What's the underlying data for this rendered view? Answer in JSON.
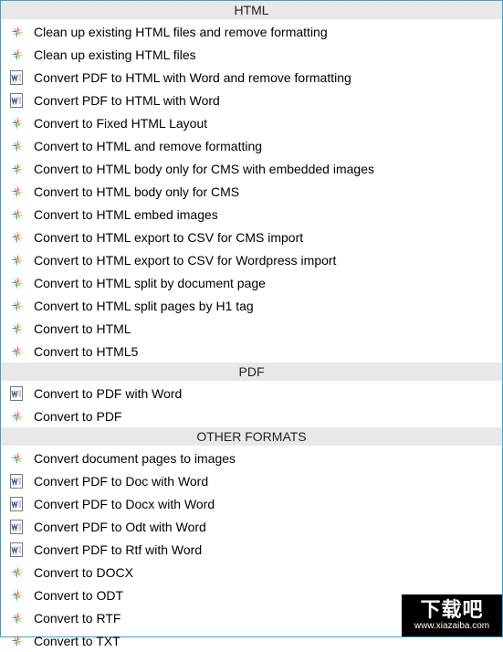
{
  "sections": [
    {
      "title": "HTML",
      "items": [
        {
          "icon": "star",
          "label": "Clean up existing HTML files and remove formatting"
        },
        {
          "icon": "star",
          "label": "Clean up existing HTML files"
        },
        {
          "icon": "word",
          "label": "Convert PDF to HTML with Word and remove formatting"
        },
        {
          "icon": "word",
          "label": "Convert PDF to HTML with Word"
        },
        {
          "icon": "star",
          "label": "Convert to Fixed HTML Layout"
        },
        {
          "icon": "star",
          "label": "Convert to HTML and remove formatting"
        },
        {
          "icon": "star",
          "label": "Convert to HTML body only for CMS with embedded images"
        },
        {
          "icon": "star",
          "label": "Convert to HTML body only for CMS"
        },
        {
          "icon": "star",
          "label": "Convert to HTML embed images"
        },
        {
          "icon": "star",
          "label": "Convert to HTML export to CSV for CMS import"
        },
        {
          "icon": "star",
          "label": "Convert to HTML export to CSV for Wordpress import"
        },
        {
          "icon": "star",
          "label": "Convert to HTML split by document page"
        },
        {
          "icon": "star",
          "label": "Convert to HTML split pages by H1 tag"
        },
        {
          "icon": "star",
          "label": "Convert to HTML"
        },
        {
          "icon": "star",
          "label": "Convert to HTML5"
        }
      ]
    },
    {
      "title": "PDF",
      "items": [
        {
          "icon": "word",
          "label": "Convert to PDF with Word"
        },
        {
          "icon": "star",
          "label": "Convert to PDF"
        }
      ]
    },
    {
      "title": "OTHER FORMATS",
      "items": [
        {
          "icon": "star",
          "label": "Convert document pages to images"
        },
        {
          "icon": "word",
          "label": "Convert PDF to Doc with Word"
        },
        {
          "icon": "word",
          "label": "Convert PDF to Docx with Word"
        },
        {
          "icon": "word",
          "label": "Convert PDF to Odt with Word"
        },
        {
          "icon": "word",
          "label": "Convert PDF to Rtf with Word"
        },
        {
          "icon": "star",
          "label": "Convert to DOCX"
        },
        {
          "icon": "star",
          "label": "Convert to ODT"
        },
        {
          "icon": "star",
          "label": "Convert to RTF"
        },
        {
          "icon": "star",
          "label": "Convert to TXT"
        }
      ]
    }
  ],
  "watermark": {
    "text": "下载吧",
    "url": "www.xiazaiba.com"
  }
}
